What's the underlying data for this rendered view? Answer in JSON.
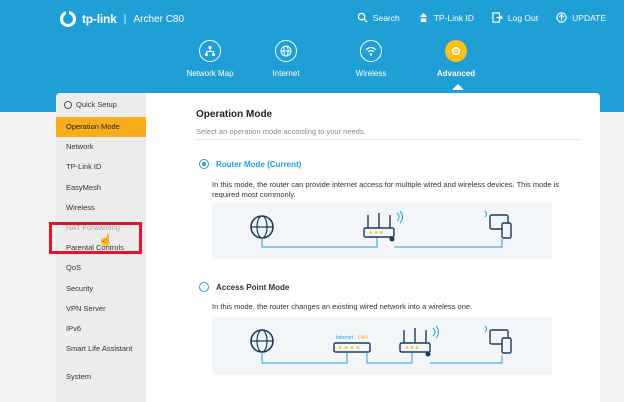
{
  "header": {
    "brand": "tp-link",
    "separator": "|",
    "model": "Archer C80",
    "top_links": {
      "search": "Search",
      "tplink_id": "TP-Link ID",
      "logout": "Log Out",
      "update": "UPDATE"
    },
    "nav": [
      {
        "label": "Network Map",
        "icon": "network-map-icon"
      },
      {
        "label": "Internet",
        "icon": "globe-icon"
      },
      {
        "label": "Wireless",
        "icon": "wifi-icon"
      },
      {
        "label": "Advanced",
        "icon": "gear-icon",
        "active": true
      }
    ]
  },
  "sidebar": {
    "quick_setup": "Quick Setup",
    "items": [
      "Operation Mode",
      "Network",
      "TP-Link ID",
      "EasyMesh",
      "Wireless",
      "NAT Forwarding",
      "Parental Controls",
      "QoS",
      "Security",
      "VPN Server",
      "IPv6",
      "Smart Life Assistant",
      "System"
    ],
    "active_item": "Operation Mode"
  },
  "content": {
    "title": "Operation Mode",
    "subtitle": "Select an operation mode according to your needs.",
    "router_mode": {
      "label": "Router Mode (Current)",
      "checked": true,
      "description": "In this mode, the router can provide internet access for multiple wired and wireless devices. This mode is required most commonly."
    },
    "ap_mode": {
      "label": "Access Point Mode",
      "checked": false,
      "description": "In this mode, the router changes an existing wired network into a wireless one.",
      "port_internet": "Internet",
      "port_lan": "LAN"
    }
  },
  "colors": {
    "header_blue": "#1e9fd6",
    "active_yellow": "#f9ad1b",
    "highlight_red": "#e8132a"
  }
}
